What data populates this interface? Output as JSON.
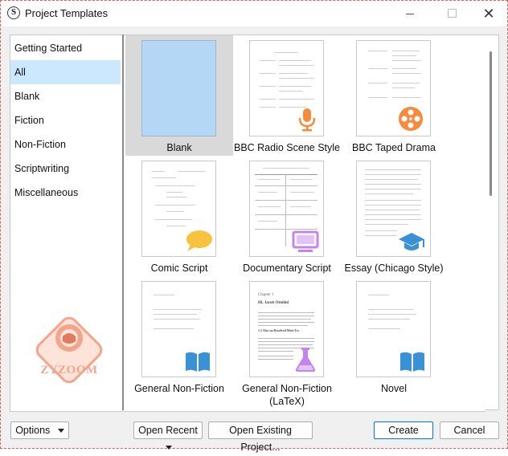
{
  "window": {
    "title": "Project Templates",
    "app_icon": "S",
    "close_glyph": "✕"
  },
  "sidebar": {
    "items": [
      {
        "label": "Getting Started"
      },
      {
        "label": "All"
      },
      {
        "label": "Blank"
      },
      {
        "label": "Fiction"
      },
      {
        "label": "Non-Fiction"
      },
      {
        "label": "Scriptwriting"
      },
      {
        "label": "Miscellaneous"
      }
    ],
    "selected": "All",
    "watermark": "ZYZOOM"
  },
  "templates": [
    {
      "name": "Blank",
      "icon": "none"
    },
    {
      "name": "BBC Radio Scene Style",
      "icon": "microphone-icon"
    },
    {
      "name": "BBC Taped Drama",
      "icon": "film-reel-icon"
    },
    {
      "name": "Comic Script",
      "icon": "speech-bubble-icon"
    },
    {
      "name": "Documentary Script",
      "icon": "monitor-icon"
    },
    {
      "name": "Essay (Chicago Style)",
      "icon": "graduation-cap-icon"
    },
    {
      "name": "General Non-Fiction",
      "icon": "book-icon"
    },
    {
      "name": "General Non-Fiction\n(LaTeX)",
      "icon": "flask-icon",
      "preview_chapter": "Chapter 1",
      "preview_heading": "Hi, Jacob Ottolini",
      "preview_section": "1.1  Also on Resolved Most Un"
    },
    {
      "name": "Novel",
      "icon": "book-icon"
    }
  ],
  "selected_template": "Blank",
  "footer": {
    "options_label": "Options",
    "open_recent_label": "Open Recent",
    "open_existing_label": "Open Existing Project...",
    "create_label": "Create",
    "cancel_label": "Cancel"
  },
  "colors": {
    "selection_blue": "#cce8ff",
    "blank_preview": "#b3d7f5",
    "accent_orange": "#f58b3c",
    "accent_yellow": "#f7c23e",
    "accent_purple": "#c483ee",
    "accent_blue": "#3a92d6",
    "primary_border": "#0078d7"
  }
}
